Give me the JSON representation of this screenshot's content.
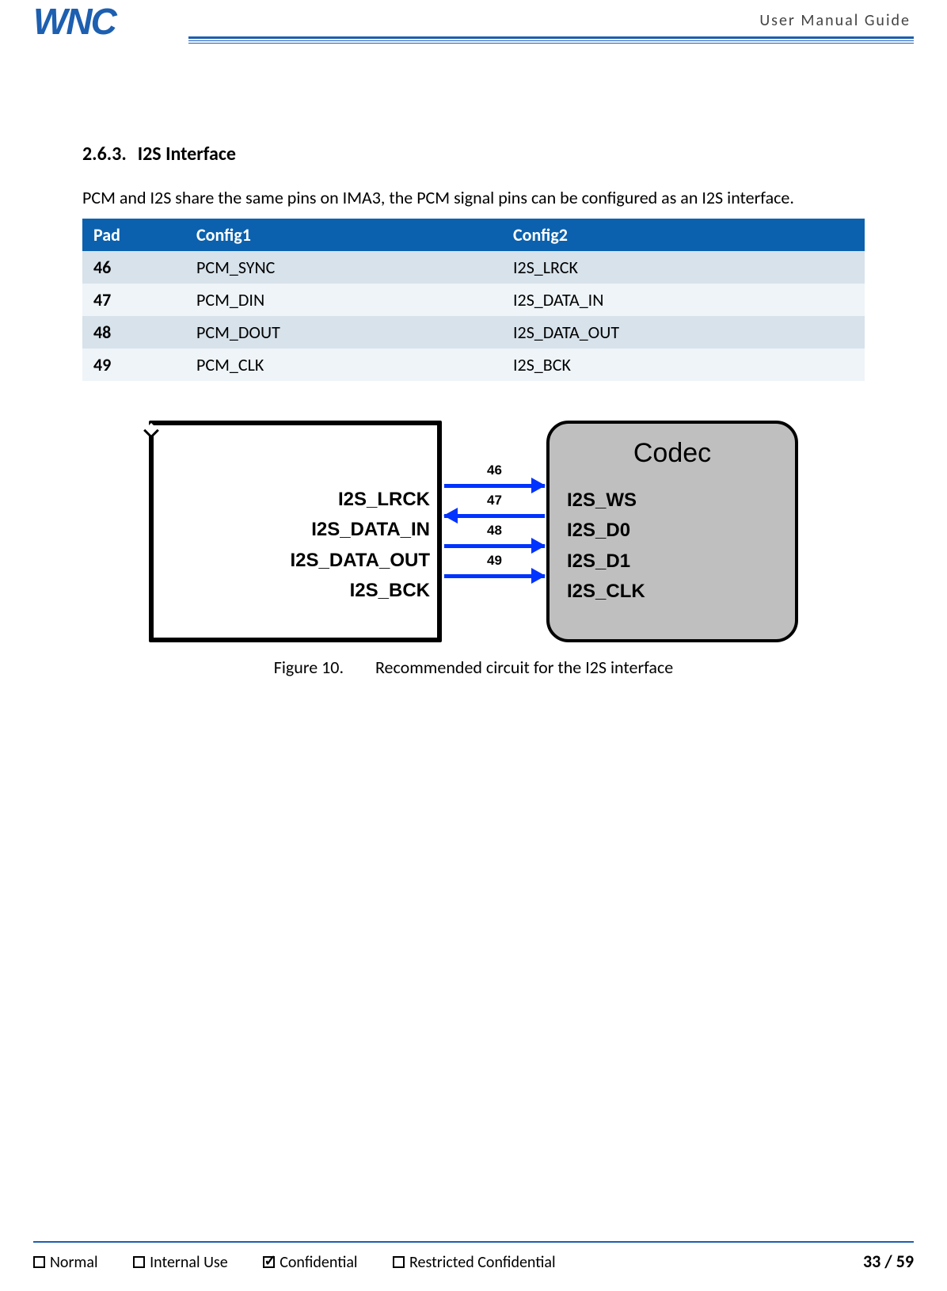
{
  "header": {
    "logo_text": "WNC",
    "title": "User  Manual  Guide"
  },
  "section": {
    "number": "2.6.3.",
    "title": "I2S Interface",
    "paragraph": "PCM and I2S share the same pins on IMA3, the PCM signal pins can be configured as an I2S interface."
  },
  "table": {
    "headers": [
      "Pad",
      "Config1",
      "Config2"
    ],
    "rows": [
      {
        "pad": "46",
        "c1": "PCM_SYNC",
        "c2": "I2S_LRCK"
      },
      {
        "pad": "47",
        "c1": "PCM_DIN",
        "c2": "I2S_DATA_IN"
      },
      {
        "pad": "48",
        "c1": "PCM_DOUT",
        "c2": "I2S_DATA_OUT"
      },
      {
        "pad": "49",
        "c1": "PCM_CLK",
        "c2": "I2S_BCK"
      }
    ]
  },
  "diagram": {
    "left_labels": [
      "I2S_LRCK",
      "I2S_DATA_IN",
      "I2S_DATA_OUT",
      "I2S_BCK"
    ],
    "right_title": "Codec",
    "right_labels": [
      "I2S_WS",
      "I2S_D0",
      "I2S_D1",
      "I2S_CLK"
    ],
    "wires": [
      {
        "pin": "46",
        "left": false,
        "right": true
      },
      {
        "pin": "47",
        "left": true,
        "right": false
      },
      {
        "pin": "48",
        "left": false,
        "right": true
      },
      {
        "pin": "49",
        "left": false,
        "right": true
      }
    ],
    "caption_num": "Figure 10.",
    "caption_text": "Recommended circuit for the I2S interface"
  },
  "footer": {
    "classifications": [
      {
        "label": "Normal",
        "checked": false
      },
      {
        "label": "Internal Use",
        "checked": false
      },
      {
        "label": "Confidential",
        "checked": true
      },
      {
        "label": "Restricted Confidential",
        "checked": false
      }
    ],
    "page_current": "33",
    "page_sep": " / ",
    "page_total": "59"
  }
}
